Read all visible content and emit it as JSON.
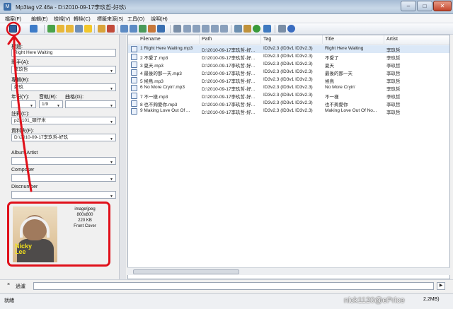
{
  "window": {
    "title": "Mp3tag v2.46a  -  D:\\2010-09-17李玖哲-好玖\\"
  },
  "menu": [
    "檔案(F)",
    "編輯(E)",
    "檢視(V)",
    "轉換(C)",
    "標籤來源(S)",
    "工具(O)",
    "說明(H)"
  ],
  "editor": {
    "title_label": "標題:",
    "title_value": "Right Here Waiting",
    "artist_label": "歌手(A):",
    "artist_value": "李玖哲",
    "album_label": "專輯(B):",
    "album_value": "好玖",
    "year_label": "年份(Y):",
    "track_label": "音軌(R):",
    "track_value": "1/9",
    "genre_label": "曲格(G):",
    "comment_label": "註釋(C):",
    "comment_value": "p2p101_碩仔米",
    "directory_label": "資料夾(F):",
    "directory_value": "D:\\2010-09-17李玖哲-好玖",
    "albumartist_label": "Album Artist",
    "composer_label": "Composer",
    "discnumber_label": "Discnumber",
    "cover": {
      "format": "image/jpeg",
      "size": "800x800",
      "filesize": "220 KB",
      "type": "Front Cover",
      "artist_text_line1": "Nicky",
      "artist_text_line2": "Lee"
    }
  },
  "list": {
    "columns": [
      "Filename",
      "Path",
      "Tag",
      "Title",
      "Artist"
    ],
    "rows": [
      {
        "filename": "1 Right Here Waiting.mp3",
        "path": "D:\\2010-09-17李玖哲-好...",
        "tag": "ID3v2.3 (ID3v1 ID3v2.3)",
        "title": "Right Here Waiting",
        "artist": "李玖哲",
        "selected": true
      },
      {
        "filename": "2 不愛了.mp3",
        "path": "D:\\2010-09-17李玖哲-好...",
        "tag": "ID3v2.3 (ID3v1 ID3v2.3)",
        "title": "不愛了",
        "artist": "李玖哲",
        "selected": false
      },
      {
        "filename": "3 夏天.mp3",
        "path": "D:\\2010-09-17李玖哲-好...",
        "tag": "ID3v2.3 (ID3v1 ID3v2.3)",
        "title": "夏天",
        "artist": "李玖哲",
        "selected": false
      },
      {
        "filename": "4 最後的那一天.mp3",
        "path": "D:\\2010-09-17李玖哲-好...",
        "tag": "ID3v2.3 (ID3v1 ID3v2.3)",
        "title": "最後的那一天",
        "artist": "李玖哲",
        "selected": false
      },
      {
        "filename": "5 候鳥.mp3",
        "path": "D:\\2010-09-17李玖哲-好...",
        "tag": "ID3v2.3 (ID3v1 ID3v2.3)",
        "title": "候鳥",
        "artist": "李玖哲",
        "selected": false
      },
      {
        "filename": "6 No More Cryin'.mp3",
        "path": "D:\\2010-09-17李玖哲-好...",
        "tag": "ID3v2.3 (ID3v1 ID3v2.3)",
        "title": "No More Cryin'",
        "artist": "李玖哲",
        "selected": false
      },
      {
        "filename": "7 不一樣.mp3",
        "path": "D:\\2010-09-17李玖哲-好...",
        "tag": "ID3v2.3 (ID3v1 ID3v2.3)",
        "title": "不一樣",
        "artist": "李玖哲",
        "selected": false
      },
      {
        "filename": "8 也不夠愛你.mp3",
        "path": "D:\\2010-09-17李玖哲-好...",
        "tag": "ID3v2.3 (ID3v1 ID3v2.3)",
        "title": "也不夠愛你",
        "artist": "李玖哲",
        "selected": false
      },
      {
        "filename": "9 Making Love Out Of ...",
        "path": "D:\\2010-09-17李玖哲-好...",
        "tag": "ID3v2.3 (ID3v1 ID3v2.3)",
        "title": "Making Love Out Of No...",
        "artist": "李玖哲",
        "selected": false
      }
    ]
  },
  "filter": {
    "label": "過濾"
  },
  "status": {
    "left": "就緒",
    "right": "2.2MB)"
  },
  "watermark": "nick1120@ePrice",
  "colors": {
    "annotation": "#e0101a",
    "selection": "#dbe8f7"
  }
}
